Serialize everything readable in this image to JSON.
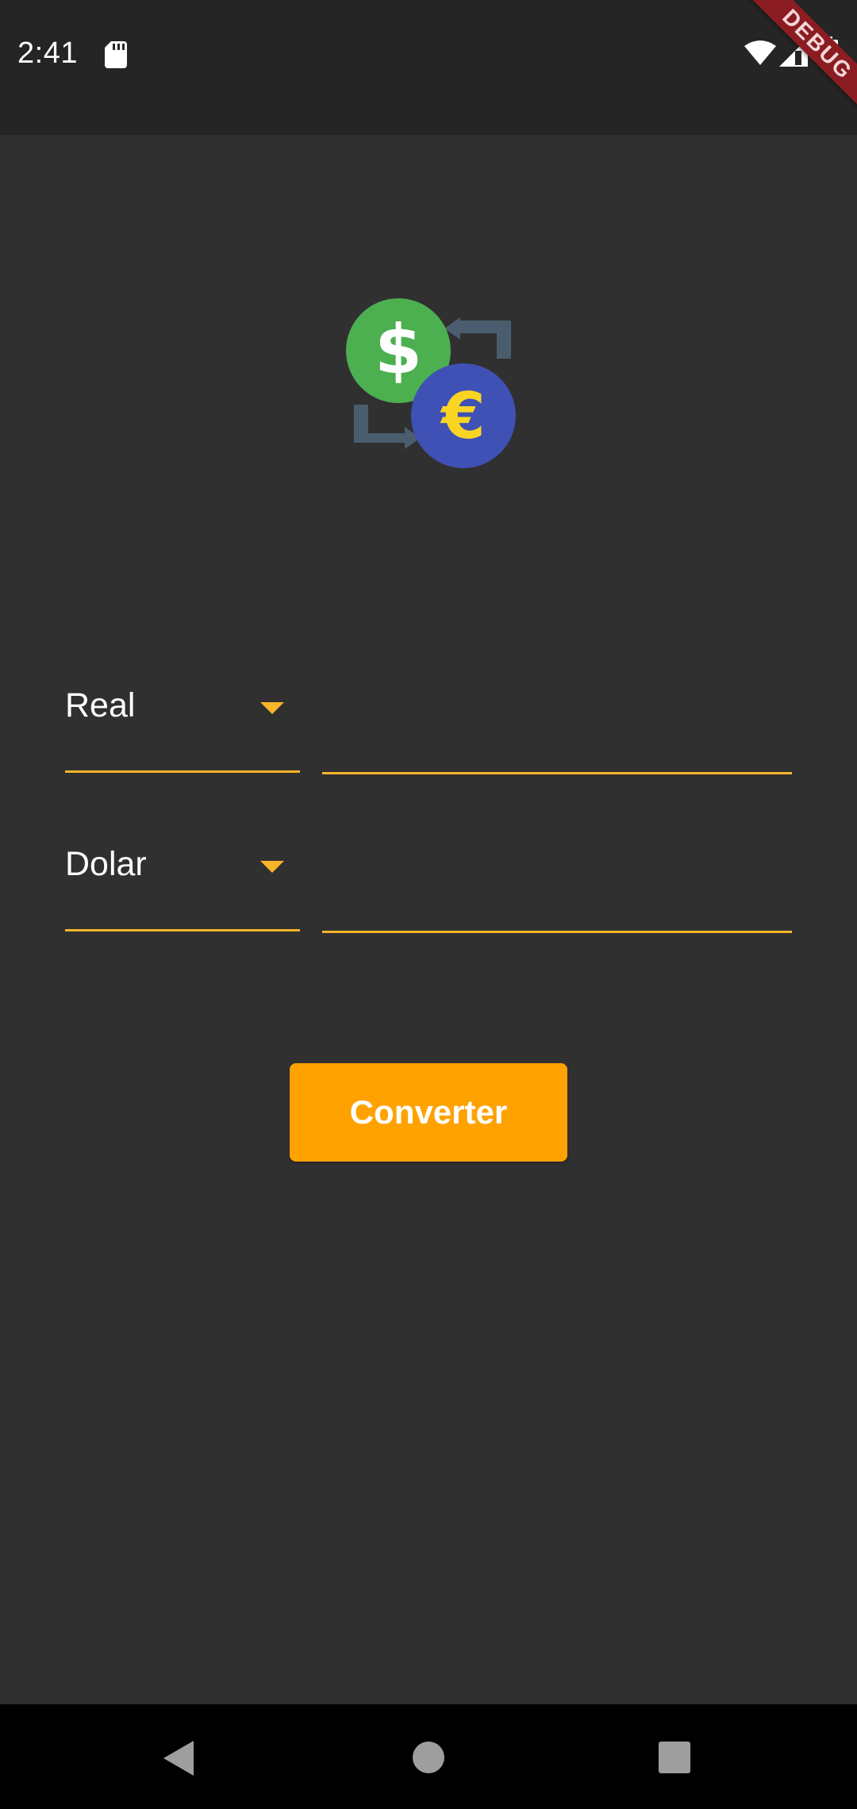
{
  "status_bar": {
    "time": "2:41",
    "icons": [
      "sd-card-icon",
      "wifi-icon",
      "signal-icon",
      "battery-icon"
    ]
  },
  "debug_banner": {
    "label": "DEBUG",
    "color": "#8a1c22"
  },
  "logo": {
    "icons": [
      "dollar-coin-icon",
      "euro-coin-icon",
      "exchange-arrows-icon"
    ],
    "dollar_symbol": "$",
    "euro_symbol": "€",
    "dollar_color": "#4caf50",
    "euro_color": "#3f51b5",
    "arrow_color": "#4a5d6e"
  },
  "form": {
    "from_currency": {
      "selected": "Real"
    },
    "from_amount": {
      "value": "",
      "placeholder": ""
    },
    "to_currency": {
      "selected": "Dolar"
    },
    "to_amount": {
      "value": "",
      "placeholder": ""
    },
    "accent_color": "#f9b52a"
  },
  "convert_button": {
    "label": "Converter",
    "color": "#ffa200"
  },
  "nav_bar": {
    "icons": [
      "back-icon",
      "home-icon",
      "recents-icon"
    ]
  }
}
